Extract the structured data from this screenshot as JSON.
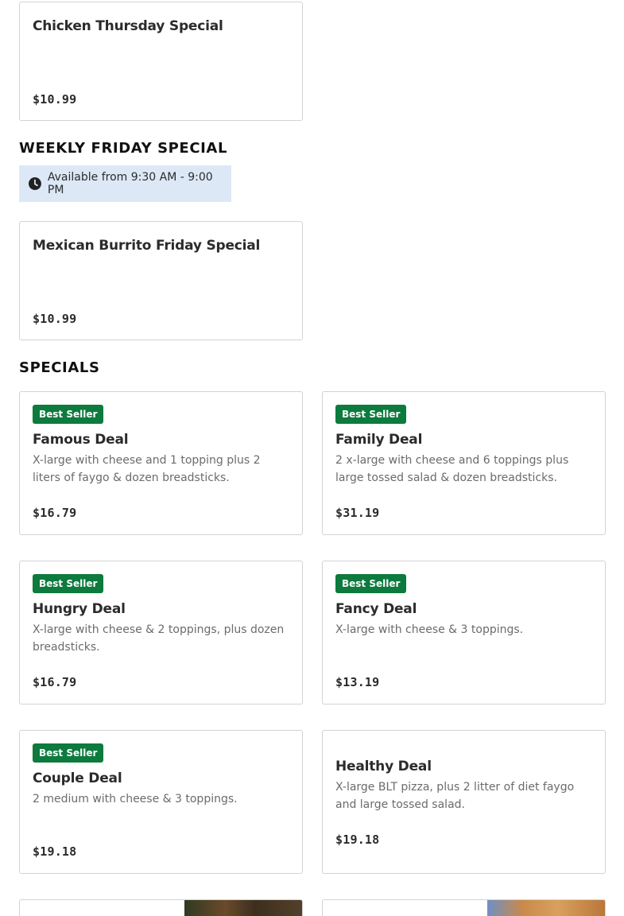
{
  "thursday_card": {
    "name": "Chicken Thursday Special",
    "price": "$10.99"
  },
  "friday_section": {
    "heading": "WEEKLY FRIDAY SPECIAL",
    "availability": "Available from 9:30 AM - 9:00 PM",
    "icon": "clock-icon",
    "card": {
      "name": "Mexican Burrito Friday Special",
      "price": "$10.99"
    }
  },
  "specials_section": {
    "heading": "SPECIALS",
    "badge_color": "#0d7a3e",
    "items": [
      {
        "badge": "Best Seller",
        "name": "Famous Deal",
        "description": "X-large with cheese and 1 topping plus 2 liters of faygo & dozen breadsticks.",
        "price": "$16.79"
      },
      {
        "badge": "Best Seller",
        "name": "Family Deal",
        "description": "2 x-large with cheese and 6 toppings plus large tossed salad & dozen breadsticks.",
        "price": "$31.19"
      },
      {
        "badge": "Best Seller",
        "name": "Hungry Deal",
        "description": "X-large with cheese & 2 toppings, plus dozen breadsticks.",
        "price": "$16.79"
      },
      {
        "badge": "Best Seller",
        "name": "Fancy Deal",
        "description": "X-large with cheese & 3 toppings.",
        "price": "$13.19"
      },
      {
        "badge": "Best Seller",
        "name": "Couple Deal",
        "description": "2 medium with cheese & 3 toppings.",
        "price": "$19.18"
      },
      {
        "badge": "",
        "name": "Healthy Deal",
        "description": "X-large BLT pizza, plus 2 litter of diet faygo and large tossed salad.",
        "price": "$19.18"
      }
    ]
  }
}
